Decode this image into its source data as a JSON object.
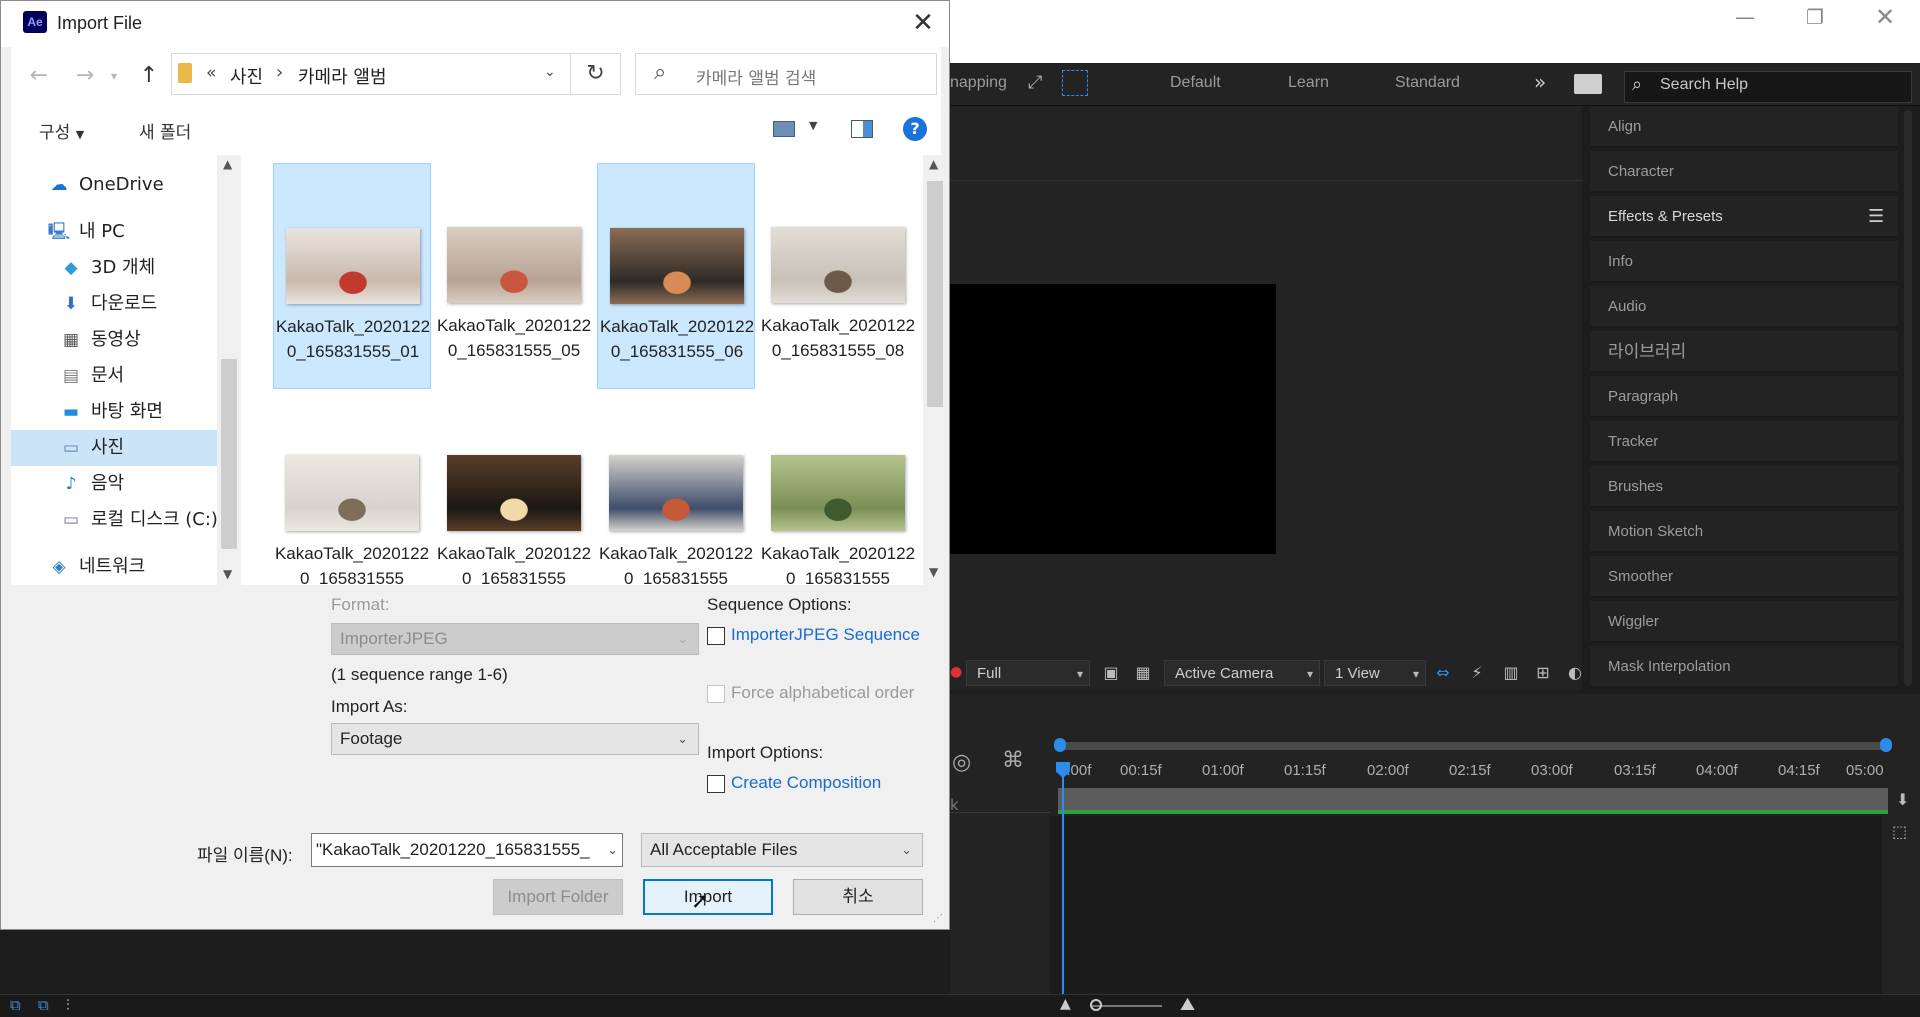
{
  "app": {
    "workspace_tabs": [
      "napping",
      "Default",
      "Learn",
      "Standard"
    ],
    "search_help_placeholder": "Search Help",
    "panels": [
      "Align",
      "Character",
      "Effects & Presets",
      "Info",
      "Audio",
      "라이브러리",
      "Paragraph",
      "Tracker",
      "Brushes",
      "Motion Sketch",
      "Smoother",
      "Wiggler",
      "Mask Interpolation"
    ],
    "viewer": {
      "resolution": "Full",
      "camera": "Active Camera",
      "views": "1 View"
    },
    "timeline": {
      "ticks": [
        "0:00f",
        "00:15f",
        "01:00f",
        "01:15f",
        "02:00f",
        "02:15f",
        "03:00f",
        "03:15f",
        "04:00f",
        "04:15f",
        "05:00"
      ],
      "left_label": "k"
    }
  },
  "dialog": {
    "title": "Import File",
    "breadcrumb": {
      "prefix": "«",
      "parts": [
        "사진",
        "카메라 앨범"
      ],
      "separator": "›"
    },
    "search_placeholder": "카메라 앨범 검색",
    "commands": {
      "organize": "구성",
      "new_folder": "새 폴더"
    },
    "nav": [
      {
        "label": "OneDrive",
        "icon": "cloud-icon"
      },
      {
        "label": "내 PC",
        "icon": "pc-icon"
      },
      {
        "label": "3D 개체",
        "icon": "cube-icon"
      },
      {
        "label": "다운로드",
        "icon": "download-icon"
      },
      {
        "label": "동영상",
        "icon": "video-icon"
      },
      {
        "label": "문서",
        "icon": "document-icon"
      },
      {
        "label": "바탕 화면",
        "icon": "desktop-icon"
      },
      {
        "label": "사진",
        "icon": "pictures-icon"
      },
      {
        "label": "음악",
        "icon": "music-icon"
      },
      {
        "label": "로컬 디스크 (C:)",
        "icon": "drive-icon"
      },
      {
        "label": "네트워크",
        "icon": "network-icon"
      }
    ],
    "files": [
      {
        "name": "KakaoTalk_20201220_165831555_01",
        "selected": true,
        "palette": [
          "#c9b9ae",
          "#e9e4df",
          "#c23a2e"
        ]
      },
      {
        "name": "KakaoTalk_20201220_165831555_05",
        "selected": false,
        "palette": [
          "#b8a394",
          "#d9cdc2",
          "#c9563e"
        ]
      },
      {
        "name": "KakaoTalk_20201220_165831555_06",
        "selected": true,
        "palette": [
          "#2f2a26",
          "#8a6d55",
          "#d98b56"
        ]
      },
      {
        "name": "KakaoTalk_20201220_165831555_08",
        "selected": false,
        "palette": [
          "#c7c1b7",
          "#e2ddd6",
          "#6d5a49"
        ]
      },
      {
        "name": "KakaoTalk_20201220_165831555",
        "selected": false,
        "palette": [
          "#d8d3cc",
          "#ebe7e1",
          "#7e6d59"
        ]
      },
      {
        "name": "KakaoTalk_20201220_165831555",
        "selected": false,
        "palette": [
          "#1b1713",
          "#5a3e28",
          "#f1d9a8"
        ]
      },
      {
        "name": "KakaoTalk_20201220_165831555",
        "selected": false,
        "palette": [
          "#3e4d6a",
          "#d6d2cc",
          "#c65a38"
        ]
      },
      {
        "name": "KakaoTalk_20201220_165831555",
        "selected": false,
        "palette": [
          "#7a8f55",
          "#b6c38e",
          "#3f5a2f"
        ]
      }
    ],
    "format_label": "Format:",
    "format_value": "ImporterJPEG",
    "sequence_range": "(1 sequence range 1-6)",
    "import_as_label": "Import As:",
    "import_as_value": "Footage",
    "sequence_options_label": "Sequence Options:",
    "sequence_checkbox": "ImporterJPEG Sequence",
    "force_alpha": "Force alphabetical order",
    "import_options_label": "Import Options:",
    "create_comp": "Create Composition",
    "filename_label": "파일 이름(N):",
    "filename_value": "\"KakaoTalk_20201220_165831555_",
    "filetype": "All Acceptable Files",
    "buttons": {
      "import_folder": "Import Folder",
      "import": "Import",
      "cancel": "취소"
    }
  }
}
